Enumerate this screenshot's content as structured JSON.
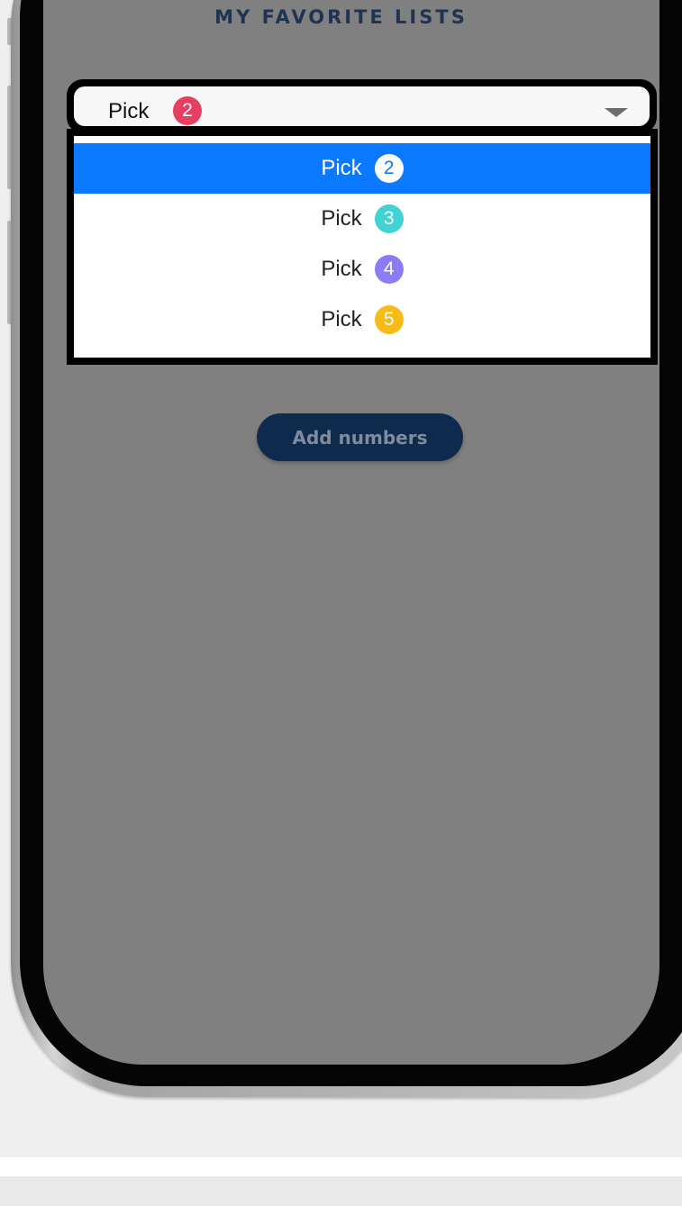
{
  "header": {
    "title": "MY FAVORITE LISTS"
  },
  "select": {
    "label": "Pick",
    "selected_badge": "2",
    "selected_badge_color": "#e63f62",
    "caret_icon": "caret-down-icon"
  },
  "dropdown": {
    "options": [
      {
        "label": "Pick",
        "badge": "2",
        "badge_color": "#ffffff",
        "badge_text_color": "#0a78ff",
        "selected": true
      },
      {
        "label": "Pick",
        "badge": "3",
        "badge_color": "#41d3d3",
        "badge_text_color": "#ffffff",
        "selected": false
      },
      {
        "label": "Pick",
        "badge": "4",
        "badge_color": "#8a7cf6",
        "badge_text_color": "#ffffff",
        "selected": false
      },
      {
        "label": "Pick",
        "badge": "5",
        "badge_color": "#f7bb16",
        "badge_text_color": "#ffffff",
        "selected": false
      }
    ],
    "selected_color": "#0a78ff"
  },
  "actions": {
    "add_numbers_label": "Add numbers"
  },
  "colors": {
    "overlay": "#808080",
    "title": "#1f3450",
    "button_bg": "#0e2a4d"
  }
}
